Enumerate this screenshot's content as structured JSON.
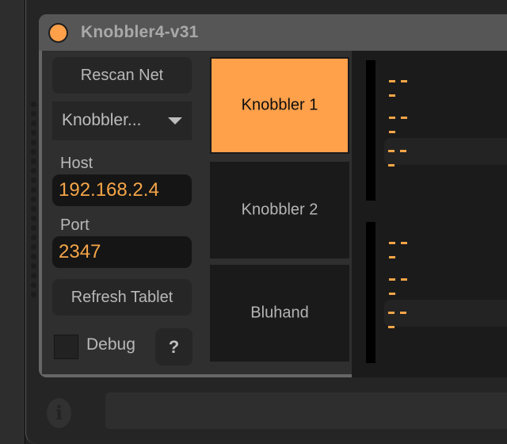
{
  "device": {
    "title": "Knobbler4-v31",
    "power_color": "#ffa04a",
    "accent": "#f5a548"
  },
  "controls": {
    "rescan_label": "Rescan Net",
    "device_select": {
      "selected": "Knobbler..."
    },
    "host_label": "Host",
    "host_value": "192.168.2.4",
    "port_label": "Port",
    "port_value": "2347",
    "refresh_label": "Refresh Tablet",
    "debug_label": "Debug",
    "debug_checked": false,
    "help_label": "?"
  },
  "tabs": [
    {
      "label": "Knobbler 1",
      "active": true
    },
    {
      "label": "Knobbler 2",
      "active": false
    },
    {
      "label": "Bluhand",
      "active": false
    }
  ],
  "slots": [
    {
      "value": "---",
      "highlighted": false
    },
    {
      "value": "---",
      "highlighted": false
    },
    {
      "value": "---",
      "highlighted": true
    },
    {
      "value": "---",
      "highlighted": false
    },
    {
      "value": "---",
      "highlighted": false
    },
    {
      "value": "---",
      "highlighted": true
    }
  ],
  "status_bar": {
    "info_icon": "i",
    "text": ""
  }
}
